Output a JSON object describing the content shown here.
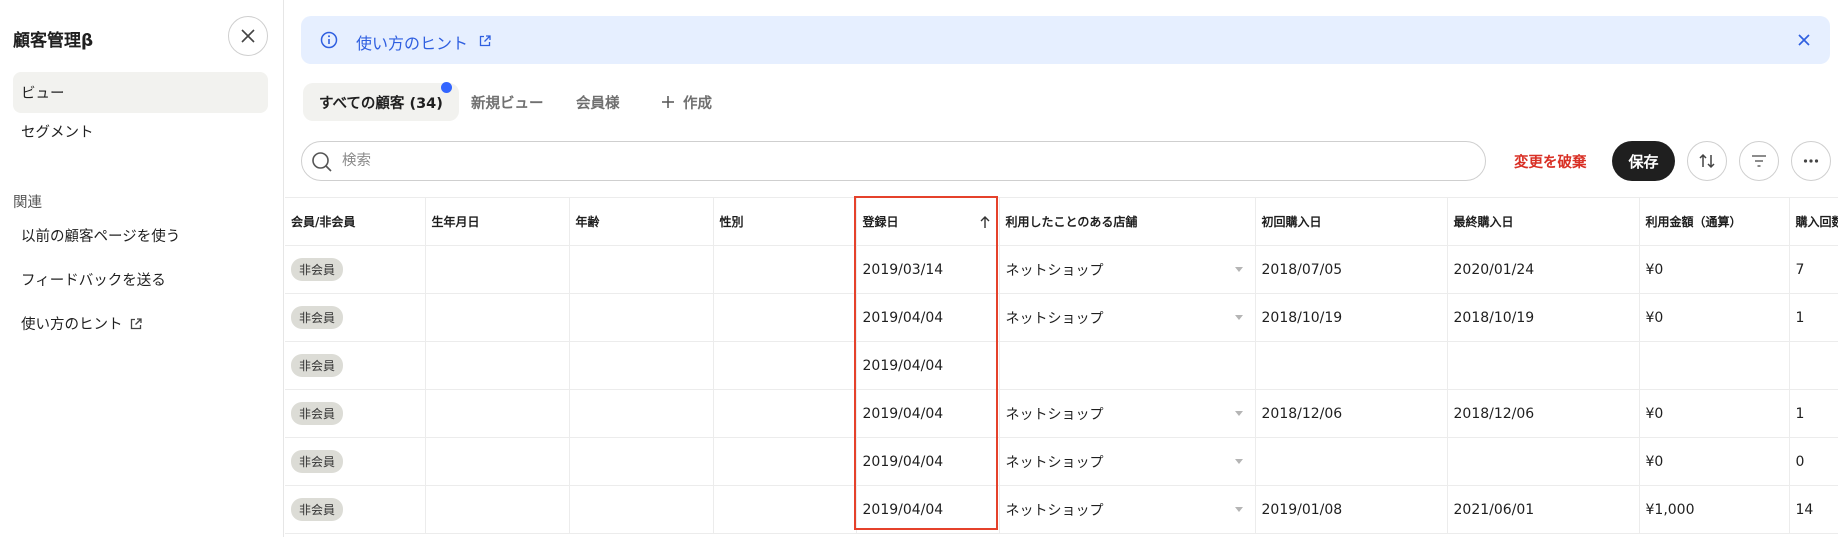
{
  "sidebar": {
    "title": "顧客管理β",
    "items": [
      {
        "label": "ビュー",
        "active": true
      },
      {
        "label": "セグメント",
        "active": false
      }
    ],
    "related_heading": "関連",
    "related_items": [
      {
        "label": "以前の顧客ページを使う"
      },
      {
        "label": "フィードバックを送る"
      },
      {
        "label": "使い方のヒント",
        "icon": "external-link-icon"
      }
    ]
  },
  "hint": {
    "text": "使い方のヒント",
    "color": "#2f5fe0",
    "background": "#e6efff"
  },
  "tabs": [
    {
      "label": "すべての顧客 (34)",
      "active": true,
      "has_unsaved_dot": true
    },
    {
      "label": "新規ビュー",
      "active": false
    },
    {
      "label": "会員様",
      "active": false
    },
    {
      "label": "作成",
      "icon": "plus-icon",
      "active": false
    }
  ],
  "toolbar": {
    "search_placeholder": "検索",
    "discard_label": "変更を破棄",
    "save_label": "保存",
    "discard_color": "#d93025"
  },
  "table": {
    "columns": [
      "会員/非会員",
      "生年月日",
      "年齢",
      "性別",
      "登録日",
      "利用したことのある店舗",
      "初回購入日",
      "最終購入日",
      "利用金額（通算）",
      "購入回数"
    ],
    "sorted_column": "登録日",
    "sort_direction": "ascending",
    "rows": [
      [
        "非会員",
        "",
        "",
        "",
        "2019/03/14",
        "ネットショップ",
        "2018/07/05",
        "2020/01/24",
        "¥0",
        "7"
      ],
      [
        "非会員",
        "",
        "",
        "",
        "2019/04/04",
        "ネットショップ",
        "2018/10/19",
        "2018/10/19",
        "¥0",
        "1"
      ],
      [
        "非会員",
        "",
        "",
        "",
        "2019/04/04",
        "",
        "",
        "",
        "",
        ""
      ],
      [
        "非会員",
        "",
        "",
        "",
        "2019/04/04",
        "ネットショップ",
        "2018/12/06",
        "2018/12/06",
        "¥0",
        "1"
      ],
      [
        "非会員",
        "",
        "",
        "",
        "2019/04/04",
        "ネットショップ",
        "",
        "",
        "¥0",
        "0"
      ],
      [
        "非会員",
        "",
        "",
        "",
        "2019/04/04",
        "ネットショップ",
        "2019/01/08",
        "2021/06/01",
        "¥1,000",
        "14"
      ]
    ]
  },
  "colors": {
    "accent_dot": "#3365ff",
    "highlight": "#e5412b",
    "save_bg": "#1f1f1f"
  }
}
